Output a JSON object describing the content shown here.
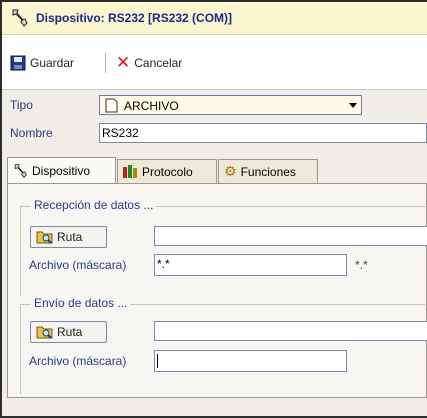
{
  "window": {
    "title": "Dispositivo: RS232 [RS232 (COM)]"
  },
  "toolbar": {
    "save_label": "Guardar",
    "cancel_label": "Cancelar"
  },
  "form": {
    "tipo_label": "Tipo",
    "tipo_value": "ARCHIVO",
    "nombre_label": "Nombre",
    "nombre_value": "RS232"
  },
  "tabs": [
    {
      "label": "Dispositivo",
      "icon": "wrench-icon",
      "active": true
    },
    {
      "label": "Protocolo",
      "icon": "books-icon",
      "active": false
    },
    {
      "label": "Funciones",
      "icon": "gears-icon",
      "active": false
    }
  ],
  "recepcion": {
    "title": "Recepción de datos ...",
    "ruta_button": "Ruta",
    "ruta_value": "",
    "mascara_label": "Archivo (máscara)",
    "mascara_value": "*.*",
    "mascara_hint": "*.*"
  },
  "envio": {
    "title": "Envío de datos ...",
    "ruta_button": "Ruta",
    "ruta_value": "",
    "mascara_label": "Archivo (máscara)",
    "mascara_value": ""
  },
  "colors": {
    "title_bg": "#fbf6cf",
    "title_text": "#1b2a8a",
    "cancel_icon": "#d61a1a"
  }
}
